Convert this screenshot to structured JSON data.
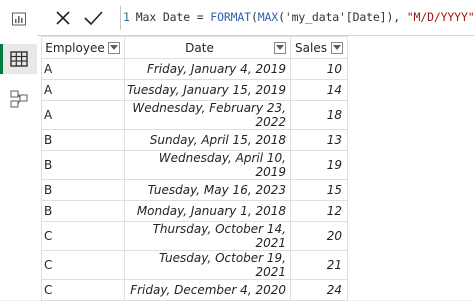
{
  "sidebar": {
    "items": [
      {
        "name": "report-view",
        "icon": "bar-chart-icon"
      },
      {
        "name": "data-view",
        "icon": "table-icon",
        "active": true
      },
      {
        "name": "model-view",
        "icon": "model-icon"
      }
    ],
    "accent_color": "#007a3d"
  },
  "formula_bar": {
    "line_number": "1",
    "measure": "Max Date = ",
    "func1": "FORMAT",
    "part2": "(",
    "func2": "MAX",
    "part3": "('my_data'[Date]), ",
    "fmt": "\"M/D/YYYY\"",
    "part4": ")"
  },
  "table": {
    "headers": [
      "Employee",
      "Date",
      "Sales"
    ],
    "rows": [
      {
        "employee": "A",
        "date": "Friday, January 4, 2019",
        "sales": "10"
      },
      {
        "employee": "A",
        "date": "Tuesday, January 15, 2019",
        "sales": "14"
      },
      {
        "employee": "A",
        "date": "Wednesday, February 23, 2022",
        "sales": "18"
      },
      {
        "employee": "B",
        "date": "Sunday, April 15, 2018",
        "sales": "13"
      },
      {
        "employee": "B",
        "date": "Wednesday, April 10, 2019",
        "sales": "19"
      },
      {
        "employee": "B",
        "date": "Tuesday, May 16, 2023",
        "sales": "15"
      },
      {
        "employee": "B",
        "date": "Monday, January 1, 2018",
        "sales": "12"
      },
      {
        "employee": "C",
        "date": "Thursday, October 14, 2021",
        "sales": "20"
      },
      {
        "employee": "C",
        "date": "Tuesday, October 19, 2021",
        "sales": "21"
      },
      {
        "employee": "C",
        "date": "Friday, December 4, 2020",
        "sales": "24"
      }
    ]
  }
}
